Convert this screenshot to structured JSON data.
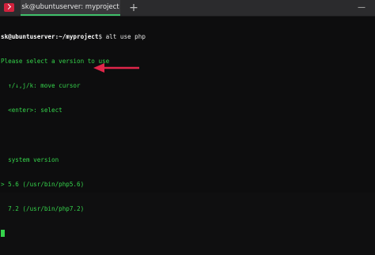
{
  "window": {
    "tab_title": "sk@ubuntuserver: myproject",
    "new_tab_glyph": "+",
    "minimize_glyph": "—"
  },
  "terminal": {
    "prompt": "sk@ubuntuserver:~/myproject",
    "command": "$ alt use php",
    "lines": [
      "Please select a version to use",
      "  ↑/↓,j/k: move cursor",
      "  <enter>: select",
      "",
      "  system version",
      "> 5.6 (/usr/bin/php5.6)",
      "  7.2 (/usr/bin/php7.2)"
    ]
  },
  "colors": {
    "terminal_text": "#35d44b",
    "arrow": "#e0264a"
  }
}
